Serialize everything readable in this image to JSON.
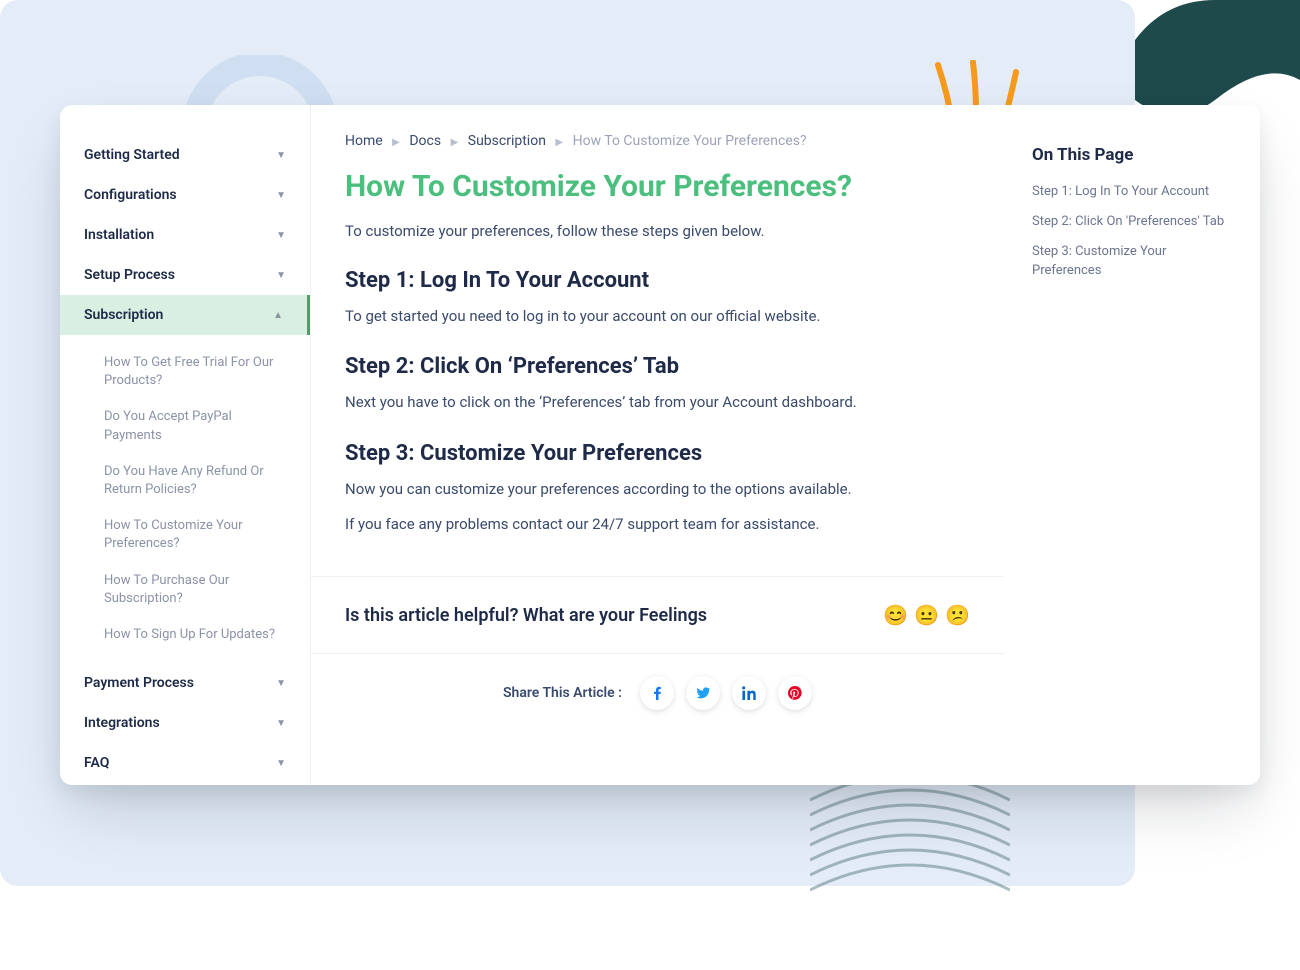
{
  "breadcrumb": {
    "items": [
      "Home",
      "Docs",
      "Subscription"
    ],
    "current": "How To Customize Your Preferences?"
  },
  "sidebar": {
    "sections": [
      {
        "label": "Getting Started",
        "expanded": false
      },
      {
        "label": "Configurations",
        "expanded": false
      },
      {
        "label": "Installation",
        "expanded": false
      },
      {
        "label": "Setup Process",
        "expanded": false
      },
      {
        "label": "Subscription",
        "expanded": true,
        "active": true
      },
      {
        "label": "Payment Process",
        "expanded": false
      },
      {
        "label": "Integrations",
        "expanded": false
      },
      {
        "label": "FAQ",
        "expanded": false
      }
    ],
    "sub_items": [
      "How To Get Free Trial For Our Products?",
      "Do You Accept PayPal Payments",
      "Do You Have Any Refund Or Return Policies?",
      "How To Customize Your Preferences?",
      "How To Purchase Our Subscription?",
      "How To Sign Up For Updates?"
    ]
  },
  "article": {
    "title": "How To Customize Your Preferences?",
    "intro": "To customize your preferences, follow these steps given below.",
    "steps": [
      {
        "heading": "Step 1: Log In To Your Account",
        "body": "To get started you need to log in to your account on our official website."
      },
      {
        "heading": "Step 2: Click On ‘Preferences’ Tab",
        "body": "Next you have to click on the ‘Preferences’ tab from your Account dashboard."
      },
      {
        "heading": "Step 3: Customize Your Preferences",
        "body": "Now you can customize your preferences according to the options available."
      }
    ],
    "closing": "If you face any problems contact our 24/7 support team for assistance."
  },
  "feedback": {
    "question": "Is this article helpful? What are your Feelings",
    "faces": [
      "😊",
      "😐",
      "😕"
    ]
  },
  "share": {
    "label": "Share This Article :",
    "networks": [
      "facebook",
      "twitter",
      "linkedin",
      "pinterest"
    ]
  },
  "toc": {
    "title": "On This Page",
    "links": [
      "Step 1: Log In To Your Account",
      "Step 2: Click On 'Preferences' Tab",
      "Step 3: Customize Your Preferences"
    ]
  },
  "colors": {
    "accent_green": "#4cbf7f",
    "accent_orange": "#f59a1e",
    "dark_teal": "#1e4a4b"
  }
}
